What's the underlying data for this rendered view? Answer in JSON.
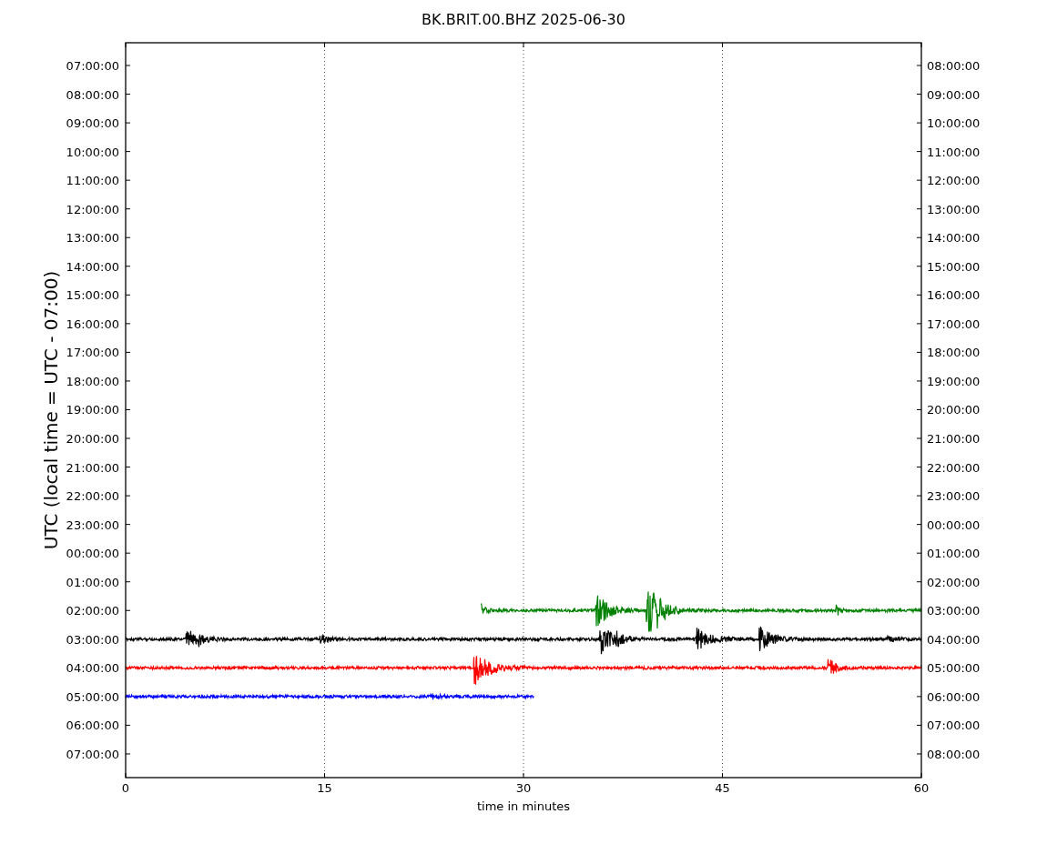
{
  "title": "BK.BRIT.00.BHZ 2025-06-30",
  "ylabel": "UTC (local time = UTC - 07:00)",
  "xlabel": "time in minutes",
  "xticks": [
    "0",
    "15",
    "30",
    "45",
    "60"
  ],
  "left_ticks": [
    "07:00:00",
    "08:00:00",
    "09:00:00",
    "10:00:00",
    "11:00:00",
    "12:00:00",
    "13:00:00",
    "14:00:00",
    "15:00:00",
    "16:00:00",
    "17:00:00",
    "18:00:00",
    "19:00:00",
    "20:00:00",
    "21:00:00",
    "22:00:00",
    "23:00:00",
    "00:00:00",
    "01:00:00",
    "02:00:00",
    "03:00:00",
    "04:00:00",
    "05:00:00",
    "06:00:00",
    "07:00:00"
  ],
  "right_ticks": [
    "08:00:00",
    "09:00:00",
    "10:00:00",
    "11:00:00",
    "12:00:00",
    "13:00:00",
    "14:00:00",
    "15:00:00",
    "16:00:00",
    "17:00:00",
    "18:00:00",
    "19:00:00",
    "20:00:00",
    "21:00:00",
    "22:00:00",
    "23:00:00",
    "00:00:00",
    "01:00:00",
    "02:00:00",
    "03:00:00",
    "04:00:00",
    "05:00:00",
    "06:00:00",
    "07:00:00",
    "08:00:00"
  ],
  "traces": [
    {
      "color": "#008000"
    },
    {
      "color": "#000000"
    },
    {
      "color": "#ff0000"
    },
    {
      "color": "#0000ff"
    }
  ]
}
